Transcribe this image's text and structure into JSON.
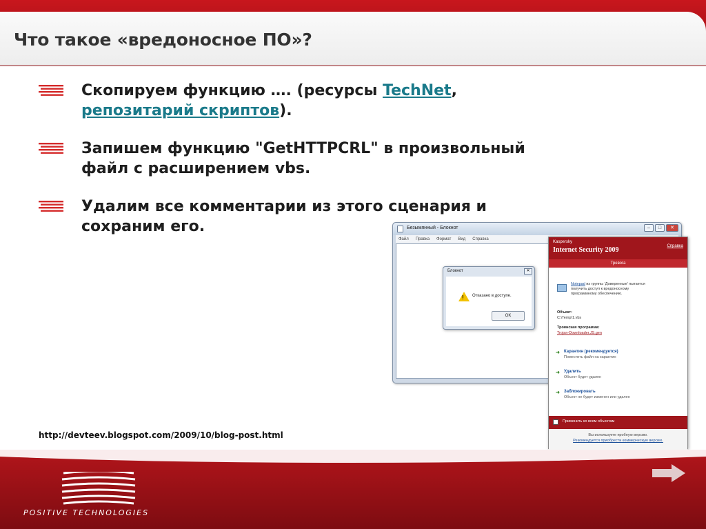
{
  "slide": {
    "title": "Что такое «вредоносное ПО»?",
    "bullets": [
      {
        "line1_pre": "Скопируем функцию …. (ресурсы ",
        "line1_link": "TechNet",
        "line1_post": ",",
        "line2_link": "репозитарий скриптов",
        "line2_post": ")."
      },
      {
        "line1": "Запишем функцию \"GetHTTPCRL\" в произвольный",
        "line2": "файл с расширением vbs."
      },
      {
        "line1": "Удалим все комментарии из этого сценария и",
        "line2": "сохраним его."
      }
    ],
    "source_url": "http://devteev.blogspot.com/2009/10/blog-post.html",
    "footer_logo": "POSITIVE TECHNOLOGIES"
  },
  "notepad": {
    "title": "Безымянный - Блокнот",
    "menu": [
      "Файл",
      "Правка",
      "Формат",
      "Вид",
      "Справка"
    ],
    "dialog": {
      "title": "Блокнот",
      "message": "Отказано в доступе.",
      "ok_label": "OK"
    }
  },
  "kaspersky": {
    "brand": "Kaspersky",
    "product": "Internet Security 2009",
    "help": "Справка",
    "banner": "Тревога",
    "message_link": "Notepad",
    "message_line1": " из группы 'Доверенные' пытается",
    "message_line2": "получить доступ к вредоносному",
    "message_line3": "программному обеспечению.",
    "object_label": "Объект:",
    "object_value": "C:\\Temp\\1.vbs",
    "trojan_label": "Троянская программа:",
    "trojan_value": "Trojan-Downloader.JS.gen",
    "actions": [
      {
        "title": "Карантин (рекомендуется)",
        "desc": "Поместить файл на карантин"
      },
      {
        "title": "Удалить",
        "desc": "Объект будет удален"
      },
      {
        "title": "Заблокировать",
        "desc": "Объект не будет изменен или удален"
      }
    ],
    "apply_all": "Применить ко всем объектам",
    "trial": "Вы используете пробную версию.",
    "buy": "Рекомендуется приобрести коммерческую версию."
  },
  "colors": {
    "brand_red": "#a0161c",
    "link_teal": "#1a7a8a"
  }
}
